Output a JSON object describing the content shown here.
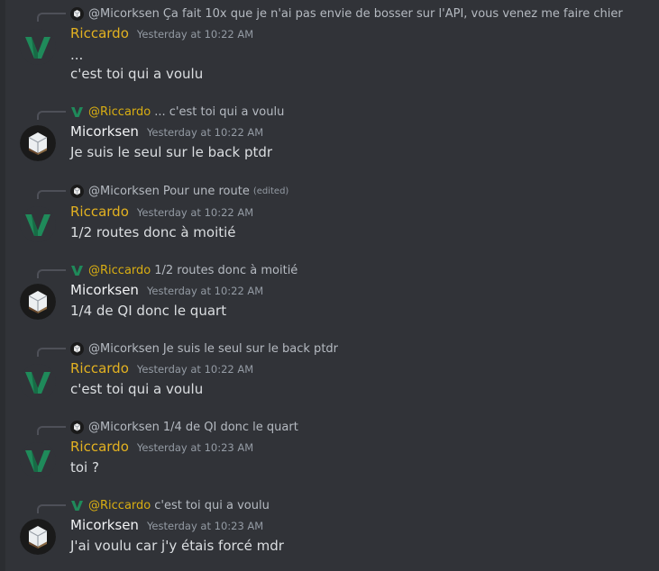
{
  "messages": [
    {
      "reply": {
        "author": "@Micorksen",
        "text": "Ça fait 10x que je n'ai pas envie de bosser sur l'API, vous venez me faire chier",
        "edited": null
      },
      "author": "Riccardo",
      "timestamp": "Yesterday at 10:22 AM",
      "lines": [
        "...",
        "c'est toi qui a voulu"
      ]
    },
    {
      "reply": {
        "author": "@Riccardo",
        "text": "... c'est toi qui a voulu",
        "edited": null
      },
      "author": "Micorksen",
      "timestamp": "Yesterday at 10:22 AM",
      "lines": [
        "Je suis le seul sur le back ptdr"
      ]
    },
    {
      "reply": {
        "author": "@Micorksen",
        "text": "Pour une route",
        "edited": "(edited)"
      },
      "author": "Riccardo",
      "timestamp": "Yesterday at 10:22 AM",
      "lines": [
        "1/2 routes donc à moitié"
      ]
    },
    {
      "reply": {
        "author": "@Riccardo",
        "text": "1/2 routes donc à moitié",
        "edited": null
      },
      "author": "Micorksen",
      "timestamp": "Yesterday at 10:22 AM",
      "lines": [
        "1/4 de QI donc le quart"
      ]
    },
    {
      "reply": {
        "author": "@Micorksen",
        "text": "Je suis le seul sur le back ptdr",
        "edited": null
      },
      "author": "Riccardo",
      "timestamp": "Yesterday at 10:22 AM",
      "lines": [
        "c'est toi qui a voulu"
      ]
    },
    {
      "reply": {
        "author": "@Micorksen",
        "text": "1/4 de QI donc le quart",
        "edited": null
      },
      "author": "Riccardo",
      "timestamp": "Yesterday at 10:23 AM",
      "lines": [
        "toi ?"
      ]
    },
    {
      "reply": {
        "author": "@Riccardo",
        "text": "c'est toi qui a voulu",
        "edited": null
      },
      "author": "Micorksen",
      "timestamp": "Yesterday at 10:23 AM",
      "lines": [
        "J'ai voulu car j'y étais forcé mdr"
      ]
    }
  ],
  "colors": {
    "background": "#313338",
    "riccardo_name": "#e3b221",
    "micorksen_name": "#f2f3f5",
    "riccardo_avatar_v": "#1f8a5a",
    "micorksen_avatar_bg": "#1a1a1a"
  },
  "icons": {
    "riccardo_avatar": "green-v-logo-icon",
    "micorksen_avatar": "white-cube-icon"
  }
}
